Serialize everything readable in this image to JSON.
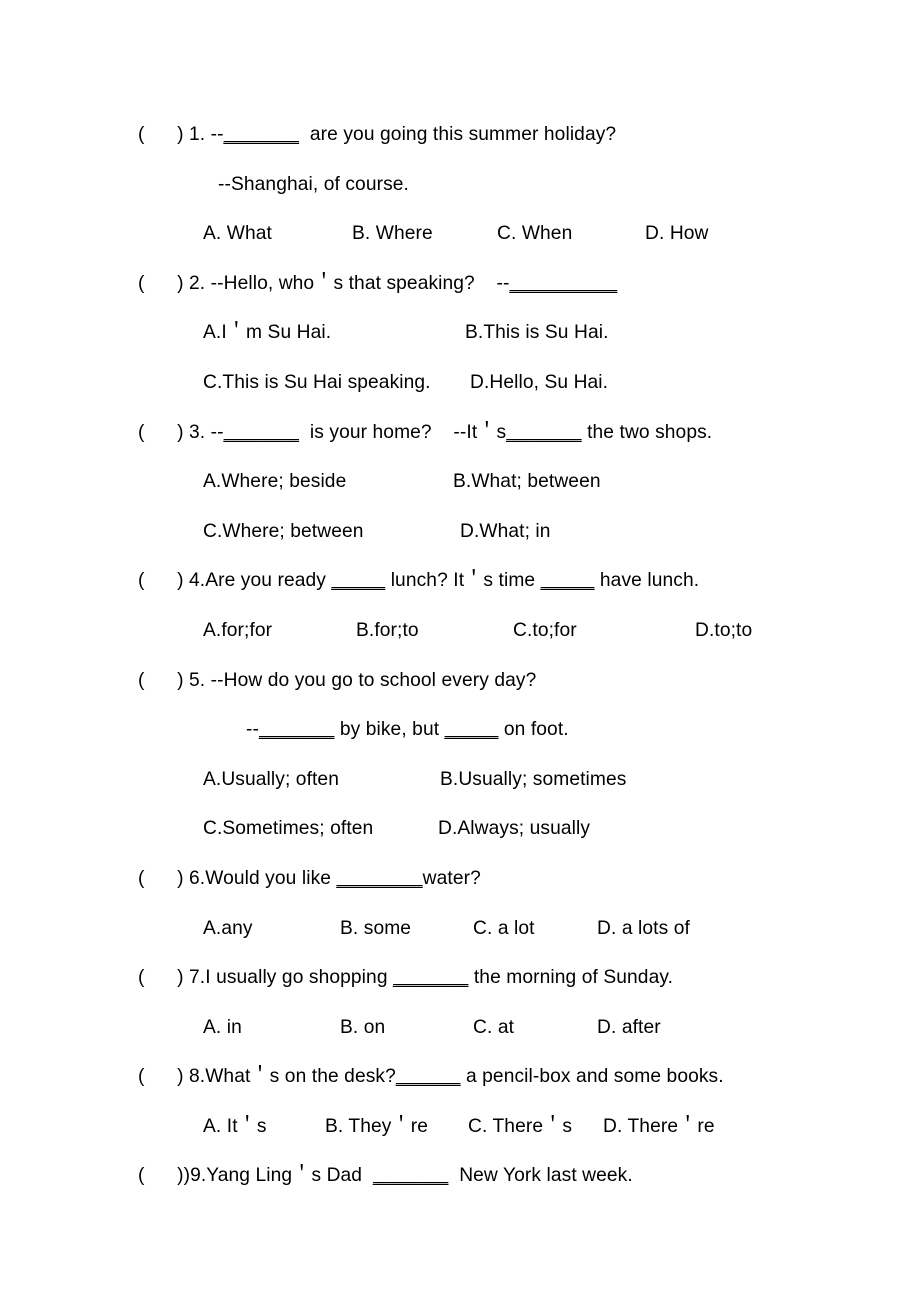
{
  "document": {
    "type": "english-multiple-choice-worksheet",
    "bracket": "(      )",
    "bracket_tight": "(      )"
  },
  "questions": [
    {
      "number": "1.",
      "stem_prefix": " 1. --",
      "stem_blank": "_______",
      "stem_suffix": "  are you going this summer holiday?",
      "reply": "--Shanghai, of course.",
      "options_layout": "four-col-w",
      "options": [
        "A. What",
        "B. Where",
        "C. When",
        "D. How"
      ]
    },
    {
      "number": "2.",
      "stem_prefix": " 2. --Hello, who＇s that speaking?    --",
      "stem_blank": "__________",
      "stem_suffix": "",
      "reply": null,
      "options_layout": "two-col",
      "options_rows": [
        {
          "variant": "cols-2a",
          "items": [
            "A.I＇m Su Hai.",
            "B.This is Su Hai."
          ]
        },
        {
          "variant": "cols-2b",
          "items": [
            "C.This is Su Hai speaking.",
            "D.Hello, Su Hai."
          ]
        }
      ]
    },
    {
      "number": "3.",
      "stem_prefix": " 3. --",
      "stem_blank": "_______",
      "stem_mid": "  is your home?    --It＇s",
      "stem_blank2": "_______",
      "stem_suffix": " the two shops.",
      "reply": null,
      "options_layout": "two-col",
      "options_rows": [
        {
          "variant": "cols-2c",
          "items": [
            "A.Where; beside",
            "B.What; between"
          ]
        },
        {
          "variant": "cols-2d",
          "items": [
            "C.Where; between",
            "D.What; in"
          ]
        }
      ]
    },
    {
      "number": "4.",
      "stem_prefix": " 4.Are you ready ",
      "stem_blank": "_____",
      "stem_mid": " lunch? It＇s time ",
      "stem_blank2": "_____",
      "stem_suffix": " have lunch.",
      "reply": null,
      "options_layout": "four-col-x",
      "options": [
        "A.for;for",
        "B.for;to",
        "C.to;for",
        "D.to;to"
      ]
    },
    {
      "number": "5.",
      "stem_prefix": " 5. --How do you go to school every day?",
      "stem_blank": "",
      "stem_suffix": "",
      "reply_prefix": "--",
      "reply_blank": "_______",
      "reply_mid": " by bike, but ",
      "reply_blank2": "_____",
      "reply_suffix": " on foot.",
      "options_layout": "two-col",
      "options_rows": [
        {
          "variant": "cols-2e",
          "items": [
            "A.Usually; often",
            "B.Usually; sometimes"
          ]
        },
        {
          "variant": "cols-2f",
          "items": [
            "C.Sometimes; often",
            "D.Always; usually"
          ]
        }
      ]
    },
    {
      "number": "6.",
      "stem_prefix": " 6.Would you like ",
      "stem_blank": "________",
      "stem_suffix": "water?",
      "reply": null,
      "options_layout": "four-col-y",
      "options": [
        "A.any",
        "B. some",
        "C. a lot",
        "D. a lots of"
      ]
    },
    {
      "number": "7.",
      "stem_prefix": " 7.I usually go shopping ",
      "stem_blank": "_______",
      "stem_suffix": " the morning of Sunday.",
      "reply": null,
      "options_layout": "four-col-y",
      "options": [
        "A. in",
        "B. on",
        "C. at",
        "D. after"
      ]
    },
    {
      "number": "8.",
      "stem_prefix": " 8.What＇s on the desk?",
      "stem_blank": "______",
      "stem_suffix": " a pencil-box and some books.",
      "reply": null,
      "options_layout": "four-col-z",
      "options": [
        "A. It＇s",
        "B. They＇re",
        "C. There＇s",
        "D. There＇re"
      ]
    },
    {
      "number": "9.",
      "stem_prefix": ")9.Yang Ling＇s Dad  ",
      "stem_blank": "_______",
      "stem_suffix": "  New York last week.",
      "reply": null,
      "options_layout": "none",
      "options": []
    }
  ]
}
